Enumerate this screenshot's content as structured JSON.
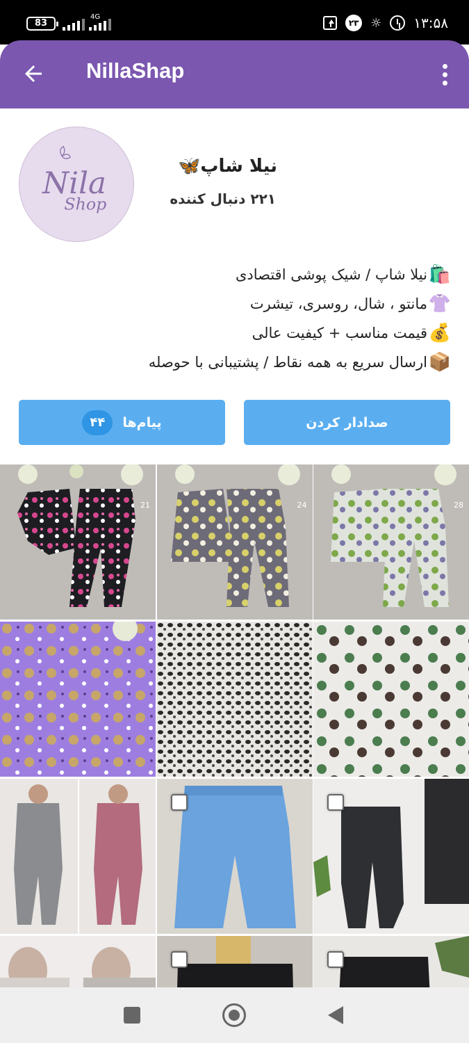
{
  "status_bar": {
    "battery": "83",
    "network": "4G",
    "notification_count": "۲۳",
    "time": "۱۳:۵۸"
  },
  "app_bar": {
    "title": "NillaShap"
  },
  "profile": {
    "name": "نیلا شاپ🦋",
    "followers": "۲۲۱ دنبال کننده",
    "avatar_text": [
      "Nila",
      "Shop"
    ]
  },
  "bio": [
    {
      "emoji": "🛍️",
      "text": "نیلا شاپ / شیک پوشی اقتصادی"
    },
    {
      "emoji": "👚",
      "text": "مانتو ، شال، روسری، تیشرت"
    },
    {
      "emoji": "💰",
      "text": "قیمت مناسب + کیفیت عالی"
    },
    {
      "emoji": "📦",
      "text": "ارسال سریع به همه نقاط / پشتیبانی با حوصله"
    }
  ],
  "buttons": {
    "mute": "صدادار کردن",
    "messages": "پیام‌ها",
    "messages_count": "۴۴"
  },
  "grid": [
    {
      "number": "21"
    },
    {
      "number": "24"
    },
    {
      "number": "28"
    }
  ],
  "colors": {
    "app_bar": "#7b57b0",
    "button": "#5aaef0",
    "badge": "#2f95e4"
  }
}
